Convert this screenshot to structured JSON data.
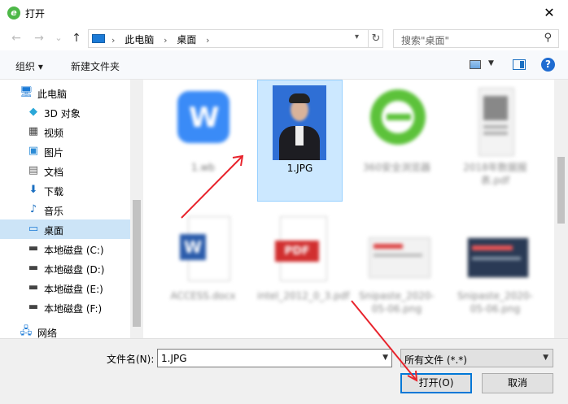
{
  "window": {
    "title": "打开",
    "close_glyph": "✕"
  },
  "nav": {
    "back_glyph": "←",
    "forward_glyph": "→",
    "recent_glyph": "⌄",
    "up_glyph": "↑",
    "crumbs": [
      "此电脑",
      "桌面"
    ],
    "crumb_sep": "›",
    "refresh_glyph": "↻",
    "search_placeholder": "搜索\"桌面\""
  },
  "toolbar": {
    "organize": "组织 ▾",
    "new_folder": "新建文件夹",
    "help": "?"
  },
  "sidebar": {
    "items": [
      {
        "label": "此电脑",
        "icon": "computer-icon",
        "glyph": "🖥",
        "color": "#1b7ad6"
      },
      {
        "label": "3D 对象",
        "icon": "3d-objects-icon",
        "glyph": "◆",
        "color": "#2aa7d8"
      },
      {
        "label": "视频",
        "icon": "video-icon",
        "glyph": "▦",
        "color": "#444444"
      },
      {
        "label": "图片",
        "icon": "picture-icon",
        "glyph": "▣",
        "color": "#2b8bd6"
      },
      {
        "label": "文档",
        "icon": "document-icon",
        "glyph": "▤",
        "color": "#666666"
      },
      {
        "label": "下载",
        "icon": "download-icon",
        "glyph": "⬇",
        "color": "#1b6fc1"
      },
      {
        "label": "音乐",
        "icon": "music-icon",
        "glyph": "♪",
        "color": "#1b6fc1"
      },
      {
        "label": "桌面",
        "icon": "desktop-icon",
        "glyph": "▭",
        "color": "#1b7ad6"
      },
      {
        "label": "本地磁盘 (C:)",
        "icon": "drive-icon",
        "glyph": "▬",
        "color": "#444444"
      },
      {
        "label": "本地磁盘 (D:)",
        "icon": "drive-icon",
        "glyph": "▬",
        "color": "#444444"
      },
      {
        "label": "本地磁盘 (E:)",
        "icon": "drive-icon",
        "glyph": "▬",
        "color": "#444444"
      },
      {
        "label": "本地磁盘 (F:)",
        "icon": "drive-icon",
        "glyph": "▬",
        "color": "#444444"
      },
      {
        "label": "网络",
        "icon": "network-icon",
        "glyph": "🖧",
        "color": "#1b7ad6"
      }
    ]
  },
  "files": [
    {
      "label": "1.wb",
      "kind": "wps-app-icon"
    },
    {
      "label": "1.JPG",
      "kind": "photo-thumbnail"
    },
    {
      "label": "360安全浏览器",
      "kind": "browser-icon"
    },
    {
      "label": "2018年数据报表.pdf",
      "kind": "pdf-thumbnail"
    },
    {
      "label": "ACCESS.docx",
      "kind": "word-doc-icon"
    },
    {
      "label": "intel_2012_0_3.pdf",
      "kind": "pdf-icon"
    },
    {
      "label": "Snipaste_2020-05-06.png",
      "kind": "screenshot-thumbnail"
    },
    {
      "label": "Snipaste_2020-05-06.png",
      "kind": "screenshot-thumbnail"
    }
  ],
  "bottom": {
    "filename_label": "文件名(N):",
    "filename_value": "1.JPG",
    "filter_value": "所有文件 (*.*)",
    "open_label": "打开(O)",
    "cancel_label": "取消"
  },
  "colors": {
    "accent": "#0078d7",
    "selection": "#cce8ff",
    "arrow": "#e8242d"
  }
}
